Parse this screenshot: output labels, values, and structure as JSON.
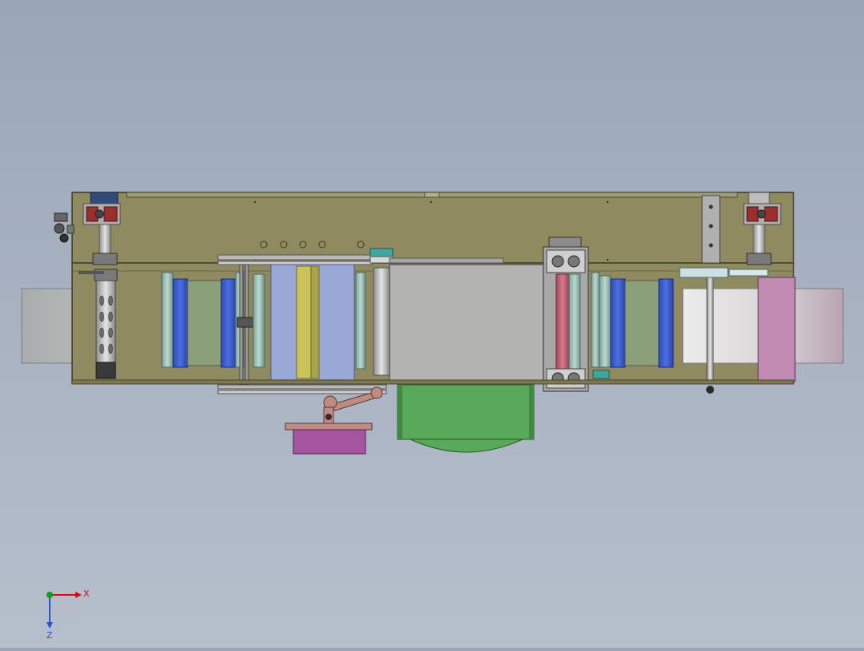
{
  "viewport": {
    "background_top": "#9aa6b8",
    "background_bottom": "#b6bfcc",
    "model": {
      "frame_color": "#8f8a60",
      "strip_color": "#aeb0b0",
      "panel_gray": "#b3b3b1",
      "blue_roller": "#3c5bc8",
      "green_panel": "#8c9f7b",
      "light_blue_panel": "#9aa8d8",
      "yellow_bar": "#c9c35a",
      "red_roller": "#c45a70",
      "green_tray": "#5aa85a",
      "magenta_box": "#a655a0",
      "pink_strip": "#c2a8b6"
    }
  },
  "triad": {
    "x_label": "X",
    "z_label": "Z",
    "x_color": "#d01010",
    "y_color": "#10a010",
    "z_color": "#2a4fd0"
  }
}
